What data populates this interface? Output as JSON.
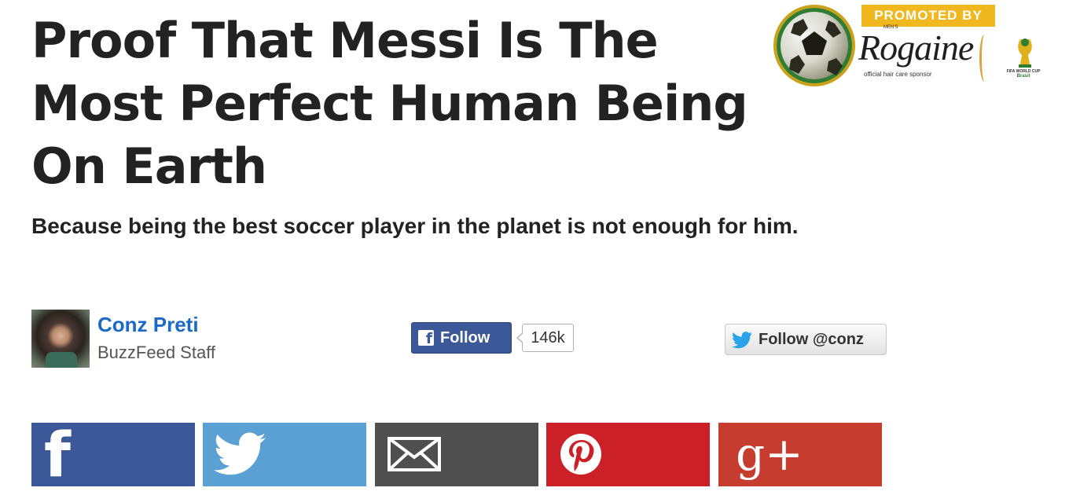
{
  "article": {
    "title": "Proof That Messi Is The Most Perfect Human Being On Earth",
    "dek": "Because being the best soccer player in the planet is not enough for him."
  },
  "promo": {
    "tag": "PROMOTED BY",
    "brand": "Rogaine",
    "brand_prefix": "MEN'S",
    "sponsor_note": "official hair care sponsor",
    "wc_line1": "FIFA WORLD CUP",
    "wc_line2": "Brasil",
    "icons": [
      "soccer-ball-icon",
      "world-cup-trophy-icon"
    ]
  },
  "author": {
    "name": "Conz Preti",
    "role": "BuzzFeed Staff"
  },
  "social": {
    "facebook_follow_label": "Follow",
    "facebook_count": "146k",
    "twitter_follow_label": "Follow @conz"
  },
  "share": {
    "buttons": [
      {
        "network": "facebook",
        "icon": "facebook-icon",
        "glyph": "f",
        "color": "#3b5998"
      },
      {
        "network": "twitter",
        "icon": "twitter-bird-icon",
        "color": "#5aa0d4"
      },
      {
        "network": "email",
        "icon": "envelope-icon",
        "color": "#4f4f4f"
      },
      {
        "network": "pinterest",
        "icon": "pinterest-icon",
        "color": "#cb2027"
      },
      {
        "network": "google-plus",
        "icon": "google-plus-icon",
        "glyph": "g+",
        "color": "#c63d2f"
      }
    ]
  },
  "colors": {
    "author_link": "#1a6ac9",
    "promo_tag": "#f0b81e",
    "text": "#222222"
  }
}
